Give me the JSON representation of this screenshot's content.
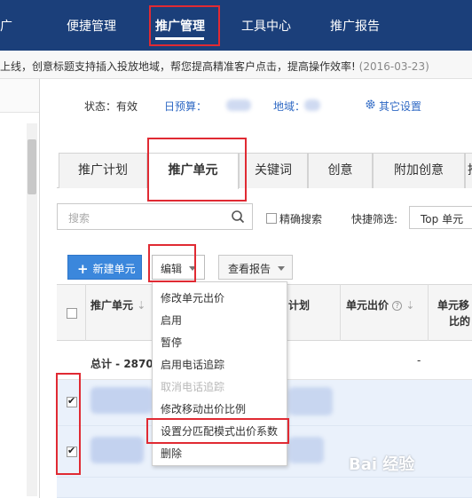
{
  "top_nav": {
    "cut_label": "广",
    "items": [
      "便捷管理",
      "推广管理",
      "工具中心",
      "推广报告"
    ],
    "active": "推广管理"
  },
  "notice": {
    "text": "上线，创意标题支持插入投放地域，帮您提高精准客户点击，提高操作效率!",
    "date": "(2016-03-23)"
  },
  "status_bar": {
    "status": "状态：有效",
    "budget": "日预算：",
    "region": "地域：",
    "settings": "其它设置"
  },
  "tabs": [
    "推广计划",
    "推广单元",
    "关键词",
    "创意",
    "附加创意",
    "推"
  ],
  "active_tab": "推广单元",
  "search": {
    "placeholder": "搜索"
  },
  "exact_search_label": "精确搜索",
  "quick_filter": {
    "label": "快捷筛选:",
    "value": "Top 单元"
  },
  "toolbar": {
    "new_unit": "新建单元",
    "edit": "编辑",
    "view_report": "查看报告"
  },
  "grid": {
    "columns": [
      "推广单元",
      "计划",
      "单元出价",
      "单元移",
      "比的"
    ],
    "total_label": "总计 - 2870",
    "total_dash": "-"
  },
  "edit_menu": {
    "items": [
      {
        "label": "修改单元出价",
        "enabled": true
      },
      {
        "label": "启用",
        "enabled": true
      },
      {
        "label": "暂停",
        "enabled": true
      },
      {
        "label": "启用电话追踪",
        "enabled": true
      },
      {
        "label": "取消电话追踪",
        "enabled": false
      },
      {
        "label": "修改移动出价比例",
        "enabled": true
      },
      {
        "label": "设置分匹配模式出价系数",
        "enabled": true
      },
      {
        "label": "删除",
        "enabled": true
      }
    ]
  },
  "watermark": "Bai 经验",
  "colors": {
    "nav_bg": "#1b3f7a",
    "highlight": "#e02a33",
    "primary_button": "#3b87dc",
    "link": "#2f69c4"
  }
}
